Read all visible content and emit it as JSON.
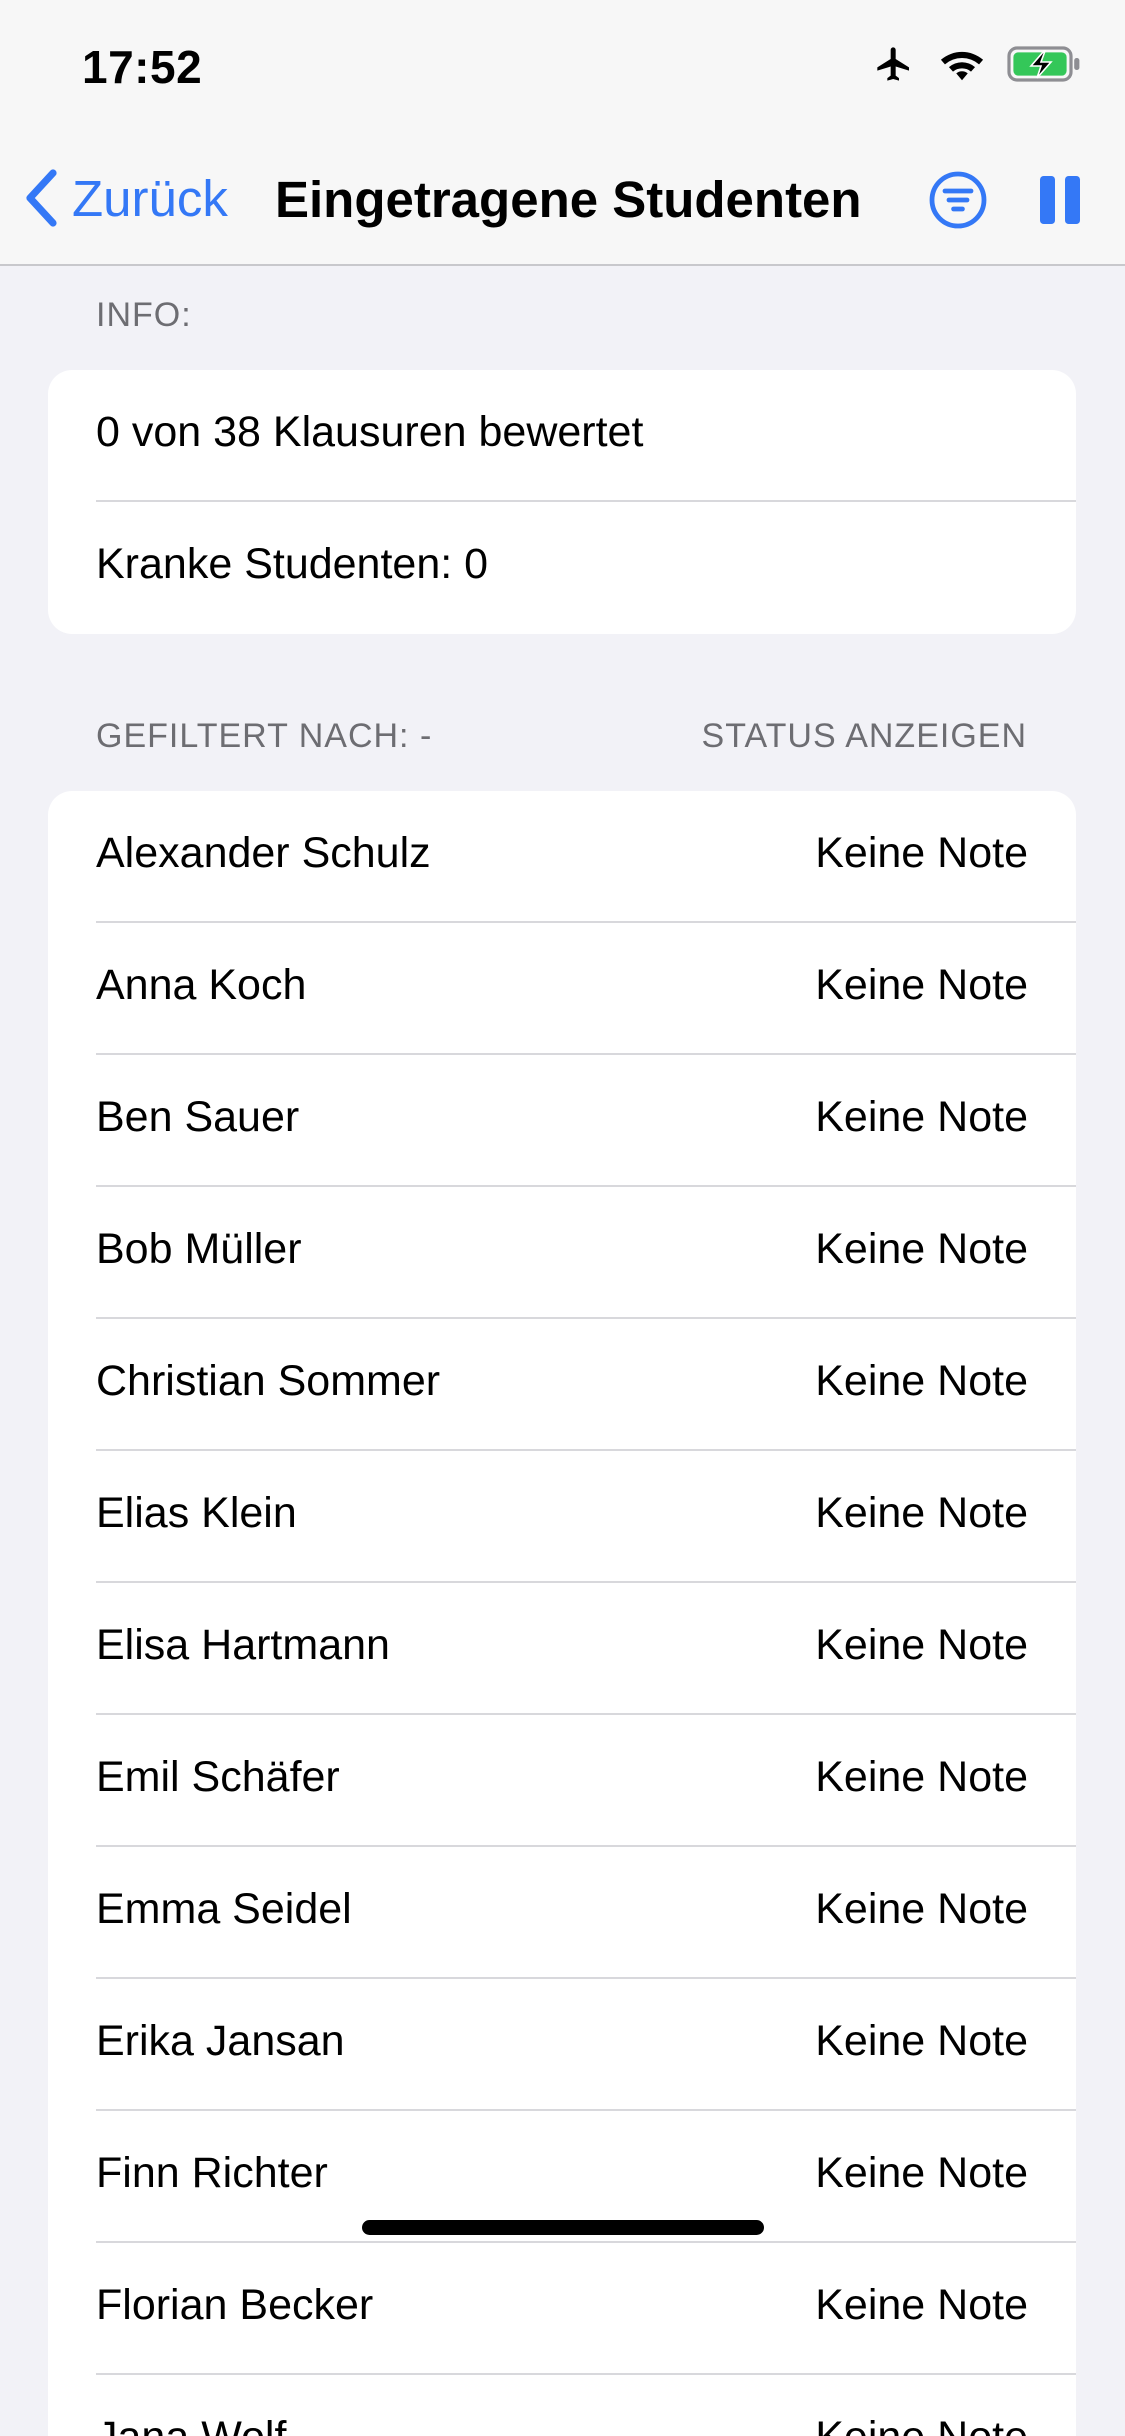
{
  "status_bar": {
    "time": "17:52",
    "icons": [
      "airplane-icon",
      "wifi-icon",
      "battery-charging-icon"
    ],
    "battery_color": "#34c759"
  },
  "nav": {
    "back_label": "Zurück",
    "title": "Eingetragene Studenten",
    "accent_color": "#3478f6",
    "icons": [
      "back-chevron-icon",
      "filter-icon",
      "pause-icon"
    ]
  },
  "info": {
    "header": "INFO:",
    "rows": [
      "0 von 38 Klausuren bewertet",
      "Kranke Studenten: 0"
    ]
  },
  "students": {
    "filter_label": "GEFILTERT NACH: -",
    "status_action": "STATUS ANZEIGEN",
    "rows": [
      {
        "name": "Alexander Schulz",
        "grade": "Keine Note"
      },
      {
        "name": "Anna Koch",
        "grade": "Keine Note"
      },
      {
        "name": "Ben Sauer",
        "grade": "Keine Note"
      },
      {
        "name": "Bob Müller",
        "grade": "Keine Note"
      },
      {
        "name": "Christian Sommer",
        "grade": "Keine Note"
      },
      {
        "name": "Elias Klein",
        "grade": "Keine Note"
      },
      {
        "name": "Elisa Hartmann",
        "grade": "Keine Note"
      },
      {
        "name": "Emil Schäfer",
        "grade": "Keine Note"
      },
      {
        "name": "Emma Seidel",
        "grade": "Keine Note"
      },
      {
        "name": "Erika Jansan",
        "grade": "Keine Note"
      },
      {
        "name": "Finn Richter",
        "grade": "Keine Note"
      },
      {
        "name": "Florian Becker",
        "grade": "Keine Note"
      },
      {
        "name": "Jana Wolf",
        "grade": "Keine Note"
      }
    ]
  }
}
